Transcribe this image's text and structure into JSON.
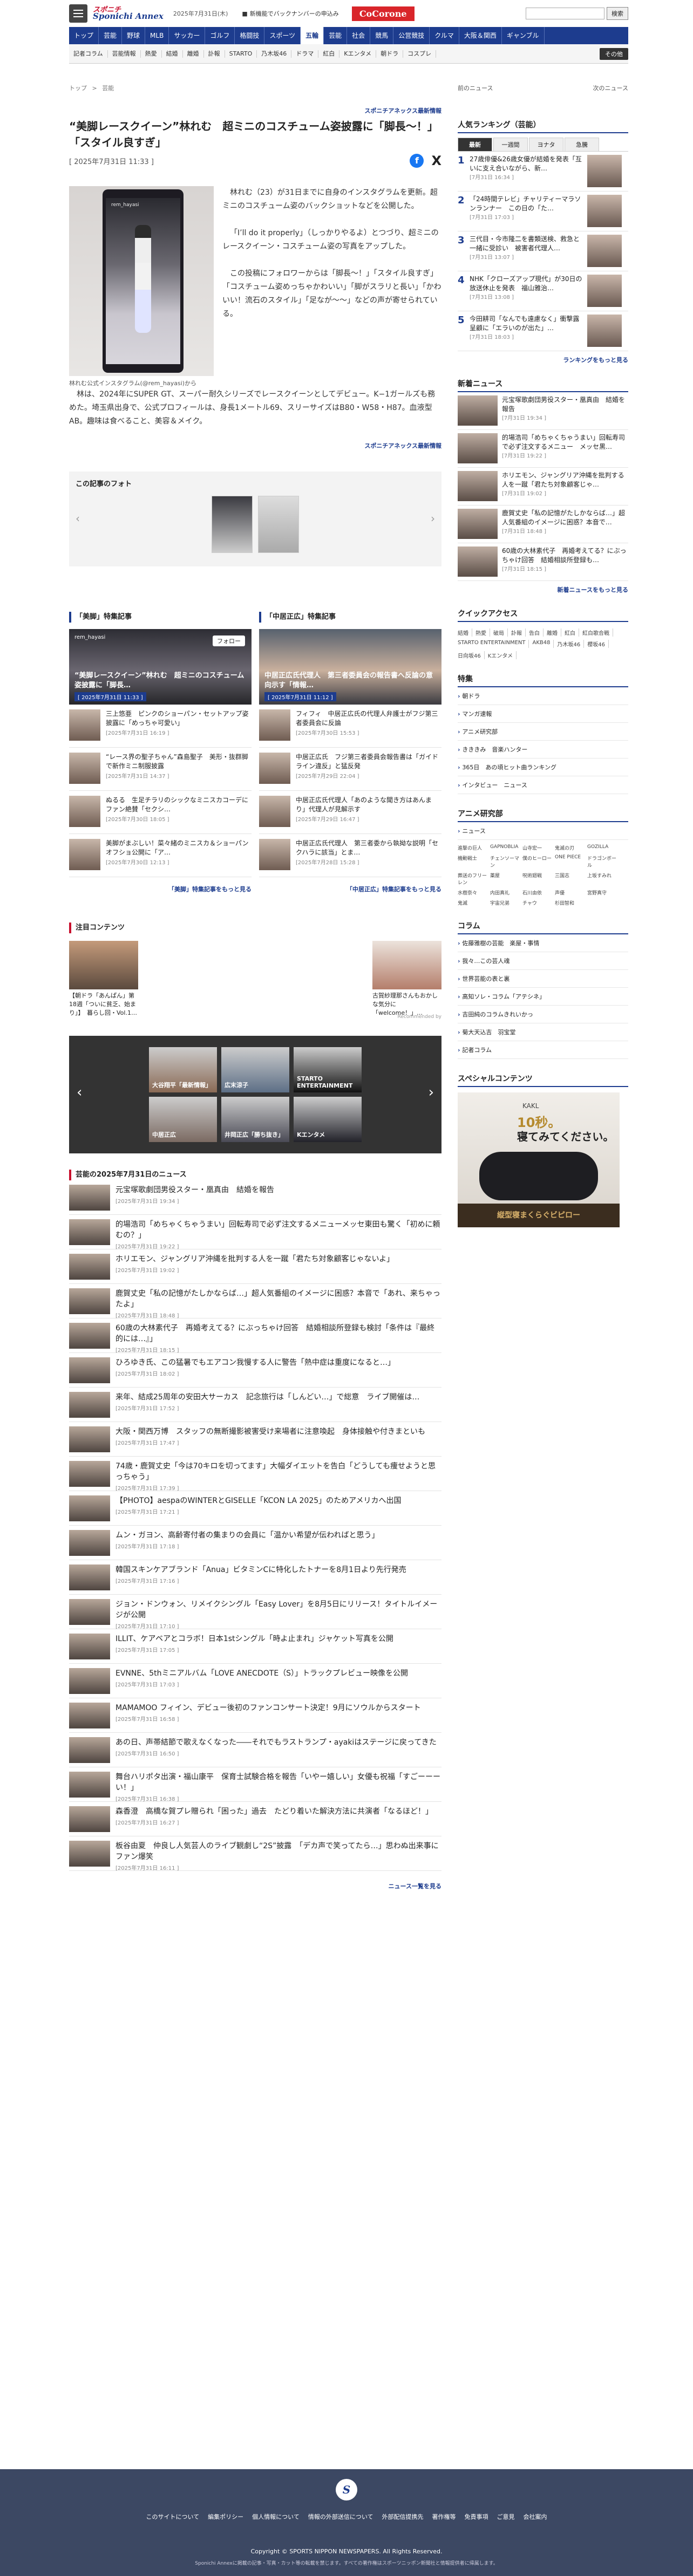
{
  "header": {
    "logo_top": "スポニチ",
    "logo_main": "Sponichi Annex",
    "date": "2025年7月31日(木)",
    "notice": "新機能でバックナンバーの申込み",
    "cocorone": "CoCorone",
    "search_btn": "検索"
  },
  "nav": {
    "items": [
      "トップ",
      "芸能",
      "野球",
      "MLB",
      "サッカー",
      "ゴルフ",
      "格闘技",
      "スポーツ",
      "五輪",
      "芸能",
      "社会",
      "競馬",
      "公営競技",
      "クルマ",
      "大阪＆関西",
      "ギャンブル"
    ],
    "active_index": 8
  },
  "subnav": {
    "items": [
      "記者コラム",
      "芸能情報",
      "熱愛",
      "結婚",
      "離婚",
      "訃報",
      "STARTO",
      "乃木坂46",
      "ドラマ",
      "紅白",
      "Kエンタメ",
      "朝ドラ",
      "コスプレ"
    ],
    "more": "その他"
  },
  "crumb": {
    "home": "トップ",
    "sep": ">",
    "cur": "芸能"
  },
  "prevnext": {
    "prev": "前のニュース",
    "next": "次のニュース"
  },
  "article": {
    "genre": "スポニチアネックス最新情報",
    "title": "“美脚レースクイーン”林れむ　超ミニのコスチューム姿披露に「脚長〜！」「スタイル良すぎ」",
    "date": "[ 2025年7月31日 11:33 ]",
    "caption": "林れむ公式インスタグラム(@rem_hayasi)から",
    "photo_account": "rem_hayasi",
    "paragraphs": [
      "林れむ（23）が31日までに自身のインスタグラムを更新。超ミニのコスチューム姿のバックショットなどを公開した。",
      "「I’ll do it properly」（しっかりやるよ）とつづり、超ミニのレースクイーン・コスチューム姿の写真をアップした。",
      "この投稿にフォロワーからは「脚長〜！」「スタイル良すぎ」「コスチューム姿めっちゃかわいい」「脚がスラリと長い」「かわいい！流石のスタイル」「足なが〜〜」などの声が寄せられている。"
    ],
    "last": "林は、2024年にSUPER GT、スーパー耐久シリーズでレースクイーンとしてデビュー。K−1ガールズも務めた。埼玉県出身で、公式プロフィールは、身長1メートル69、スリーサイズはB80・W58・H87。血液型AB。趣味は食べること、美容＆メイク。",
    "credit": "スポニチアネックス最新情報"
  },
  "share": {
    "fb": "f",
    "x": "X"
  },
  "slider": {
    "title": "この記事のフォト"
  },
  "feature_a": {
    "title": "「美脚」特集記事",
    "account": "rem_hayasi",
    "follow": "フォロー",
    "banner_title": "“美脚レースクイーン”林れむ　超ミニのコスチューム姿披露に「脚長…",
    "banner_date": "[ 2025年7月31日 11:33 ]",
    "items": [
      {
        "t": "三上悠亜　ピンクのショーパン・セットアップ姿披露に「めっちゃ可愛い」",
        "d": "[2025年7月31日 16:19 ]"
      },
      {
        "t": "“レース界の聖子ちゃん”森島聖子　美形・抜群脚で新作ミニ制服披露",
        "d": "[2025年7月31日 14:37 ]"
      },
      {
        "t": "ぬるる　生足チラリのシックなミニスカコーデにファン絶賛「セクシ…",
        "d": "[2025年7月30日 18:05 ]"
      },
      {
        "t": "美脚がまぶしい！菜々緒のミニスカ＆ショーパンオフショ公開に「ア…",
        "d": "[2025年7月30日 12:13 ]"
      }
    ],
    "more": "「美脚」特集記事をもっと見る"
  },
  "feature_b": {
    "title": "「中居正広」特集記事",
    "banner_title": "中居正広氏代理人　第三者委員会の報告書へ反論の意向示す「情報…",
    "banner_date": "[ 2025年7月31日 11:12 ]",
    "items": [
      {
        "t": "フィフィ　中居正広氏の代理人弁護士がフジ第三者委員会に反論",
        "d": "[2025年7月30日 15:53 ]"
      },
      {
        "t": "中居正広氏　フジ第三者委員会報告書は「ガイドライン違反」と猛反発",
        "d": "[2025年7月29日 22:04 ]"
      },
      {
        "t": "中居正広氏代理人「あのような聞き方はあんまり」代理人が見解示す",
        "d": "[2025年7月29日 16:47 ]"
      },
      {
        "t": "中居正広氏代理人　第三者委から執拗な説明「セクハラに該当」とま…",
        "d": "[2025年7月28日 15:28 ]"
      }
    ],
    "more": "「中居正広」特集記事をもっと見る"
  },
  "attention": {
    "title": "注目コンテンツ",
    "items": [
      {
        "t": "【朝ドラ「あんぱん」第18週「ついに貧乏、始まり」】　暮らし回・Vol.1…"
      },
      {
        "t": "古賀紗理那さんもおかしな気分に「welcome！」…"
      }
    ],
    "rec": "Recommended by"
  },
  "carousel": {
    "items": [
      "大谷翔平「最新情報」",
      "広末涼子",
      "STARTO ENTERTAINMENT",
      "中居正広",
      "井岡正広「勝ち抜き」",
      "Kエンタメ"
    ]
  },
  "newslist": {
    "title": "芸能の2025年7月31日のニュース",
    "items": [
      {
        "t": "元宝塚歌劇団男役スター・凰真由　結婚を報告",
        "d": "[2025年7月31日 19:34 ]"
      },
      {
        "t": "的場浩司「めちゃくちゃうまい」回転寿司で必ず注文するメニューメッセ東田も驚く「初めに頼むの？」",
        "d": "[2025年7月31日 19:22 ]"
      },
      {
        "t": "ホリエモン、ジャングリア沖縄を批判する人を一蹴「君たち対象顧客じゃないよ」",
        "d": "[2025年7月31日 19:02 ]"
      },
      {
        "t": "鹿賀丈史「私の記憶がたしかならば…」超人気番組のイメージに困惑？本音で「あれ、来ちゃったよ」",
        "d": "[2025年7月31日 18:48 ]"
      },
      {
        "t": "60歳の大林素代子　再婚考えてる？にぶっちゃけ回答　結婚相談所登録も検討「条件は『最終的には…』」",
        "d": "[2025年7月31日 18:15 ]"
      },
      {
        "t": "ひろゆき氏、この猛暑でもエアコン我慢する人に警告「熱中症は重度になると…」",
        "d": "[2025年7月31日 18:02 ]"
      },
      {
        "t": "来年、結成25周年の安田大サーカス　記念旅行は「しんどい…」で総意　ライブ開催は…",
        "d": "[2025年7月31日 17:52 ]"
      },
      {
        "t": "大阪・関西万博　スタッフの無断撮影被害受け来場者に注意喚起　身体接触や付きまといも",
        "d": "[2025年7月31日 17:47 ]"
      },
      {
        "t": "74歳・鹿賀丈史「今は70キロを切ってます」大幅ダイエットを告白「どうしても痩せようと思っちゃう」",
        "d": "[2025年7月31日 17:39 ]"
      },
      {
        "t": "【PHOTO】aespaのWINTERとGISELLE「KCON LA 2025」のためアメリカへ出国",
        "d": "[2025年7月31日 17:21 ]"
      },
      {
        "t": "ムン・ガヨン、高齢寄付者の集まりの会員に「温かい希望が伝わればと思う」",
        "d": "[2025年7月31日 17:18 ]"
      },
      {
        "t": "韓国スキンケアブランド「Anua」ビタミンCに特化したトナーを8月1日より先行発売",
        "d": "[2025年7月31日 17:16 ]"
      },
      {
        "t": "ジョン・ドンウォン、リメイクシングル「Easy Lover」を8月5日にリリース！タイトルイメージが公開",
        "d": "[2025年7月31日 17:10 ]"
      },
      {
        "t": "ILLIT、ケアベアとコラボ！日本1stシングル「時よ止まれ」ジャケット写真を公開",
        "d": "[2025年7月31日 17:05 ]"
      },
      {
        "t": "EVNNE、5thミニアルバム「LOVE ANECDOTE（S）」トラックプレビュー映像を公開",
        "d": "[2025年7月31日 17:03 ]"
      },
      {
        "t": "MAMAMOO フィイン、デビュー後初のファンコンサート決定！9月にソウルからスタート",
        "d": "[2025年7月31日 16:58 ]"
      },
      {
        "t": "あの日、声帯結節で歌えなくなった――それでもラストランプ・ayakiはステージに戻ってきた",
        "d": "[2025年7月31日 16:50 ]"
      },
      {
        "t": "舞台ハリポタ出演・福山康平　保育士試験合格を報告「いやー嬉しい」女優も祝福「すごーーーい！」",
        "d": "[2025年7月31日 16:38 ]"
      },
      {
        "t": "森香澄　高橋な賀プレ贈られ「困った」過去　たどり着いた解決方法に共演者「なるほど！」",
        "d": "[2025年7月31日 16:27 ]"
      },
      {
        "t": "板谷由夏　仲良し人気芸人のライブ観劇し“2S”披露　「デカ声で笑ってたら…」思わぬ出来事にファン爆笑",
        "d": "[2025年7月31日 16:11 ]"
      }
    ],
    "more": "ニュース一覧を見る"
  },
  "side": {
    "ranking": {
      "title": "人気ランキング（芸能）",
      "tabs": [
        "最新",
        "一週間",
        "ヨナタ",
        "急騰"
      ],
      "items": [
        {
          "n": "1",
          "t": "27歳俳優&26歳女優が結婚を発表「互いに支え合いながら、新…",
          "d": "[7月31日 16:34 ]"
        },
        {
          "n": "2",
          "t": "「24時間テレビ」チャリティーマラソンランナー　この日の「た…",
          "d": "[7月31日 17:03 ]"
        },
        {
          "n": "3",
          "t": "三代目・今市隆二を書類送検、救急と一緒に受診い　被害者代理人…",
          "d": "[7月31日 13:07 ]"
        },
        {
          "n": "4",
          "t": "NHK「クローズアップ現代」が30日の放送休止を発表　福山雅治…",
          "d": "[7月31日 13:08 ]"
        },
        {
          "n": "5",
          "t": "今田耕司「なんでも遠慮なく」衝撃露呈顧に「エラいのが出た」…",
          "d": "[7月31日 18:03 ]"
        }
      ],
      "more": "ランキングをもっと見る"
    },
    "newnews": {
      "title": "新着ニュース",
      "items": [
        {
          "t": "元宝塚歌劇団男役スター・凰真由　結婚を報告",
          "d": "[7月31日 19:34 ]"
        },
        {
          "t": "的場浩司「めちゃくちゃうまい」回転寿司で必ず注文するメニュー　メッセ黒…",
          "d": "[7月31日 19:22 ]"
        },
        {
          "t": "ホリエモン、ジャングリア沖縄を批判する人を一蹴「君たち対象顧客じゃ…",
          "d": "[7月31日 19:02 ]"
        },
        {
          "t": "鹿賀丈史「私の記憶がたしかならば…」超人気番組のイメージに困惑？本音で…",
          "d": "[7月31日 18:48 ]"
        },
        {
          "t": "60歳の大林素代子　再婚考えてる？にぶっちゃけ回答　結婚相談所登録も…",
          "d": "[7月31日 18:15 ]"
        }
      ],
      "more": "新着ニュースをもっと見る"
    },
    "quick": {
      "title": "クイックアクセス",
      "items": [
        "結婚",
        "熱愛",
        "破局",
        "訃報",
        "告白",
        "離婚",
        "紅白",
        "紅白歌合戦",
        "STARTO ENTERTAINMENT",
        "AKB48",
        "乃木坂46",
        "櫻坂46",
        "日向坂46",
        "Kエンタメ"
      ]
    },
    "special": {
      "title": "特集",
      "items": [
        "朝ドラ",
        "マンガ速報",
        "アニメ研究部",
        "きききみ　音楽ハンター",
        "365日　あの頃ヒット曲ランキング"
      ],
      "extra": "インタビュー　ニュース"
    },
    "anime": {
      "title": "アニメ研究部",
      "link": "ニュース",
      "items": [
        "進撃の巨人",
        "GAPNOBLIA",
        "山寺宏一",
        "鬼滅の刃",
        "GOZILLA",
        "機動戦士",
        "チェンソーマン",
        "僕のヒーロー",
        "ONE PIECE",
        "ドラゴンボール",
        "葬送のフリーレン",
        "薬屋",
        "呪術廻戦",
        "三国志",
        "上坂すみれ",
        "水樹奈々",
        "内田真礼",
        "石川由依",
        "声優",
        "宮野真守",
        "鬼滅",
        "宇宙兄弟",
        "チャウ",
        "杉田智和"
      ]
    },
    "column": {
      "title": "コラム",
      "items": [
        "佐藤雅樹の芸能　楽屋・事情",
        "我々…この芸人魂",
        "世界芸能の表と裏",
        "高知ソレ・コラム「アテシネ」",
        "吉田純のコラムきれいかっ",
        "菊大天込吉　羽宝堂",
        "記者コラム"
      ]
    },
    "sponsor": {
      "title": "スペシャルコンテンツ",
      "ad_brand": "KAKL",
      "ad_line1": "10秒。",
      "ad_line2": "寝てみてください。",
      "ad_cta": "縦型寝まくらぐビピロー"
    }
  },
  "footer": {
    "logo": "S",
    "links": [
      "このサイトについて",
      "編集ポリシー",
      "個人情報について",
      "情報の外部送信について",
      "外部配信提携先",
      "著作権等",
      "免責事項",
      "ご意見",
      "会社案内"
    ],
    "copy": "Copyright © SPORTS NIPPON NEWSPAPERS. All Rights Reserved.",
    "note": "Sponichi Annexに掲載の記事・写真・カット等の転載を禁じます。すべての著作権はスポーツニッポン新聞社と情報提供者に帰属します。"
  }
}
